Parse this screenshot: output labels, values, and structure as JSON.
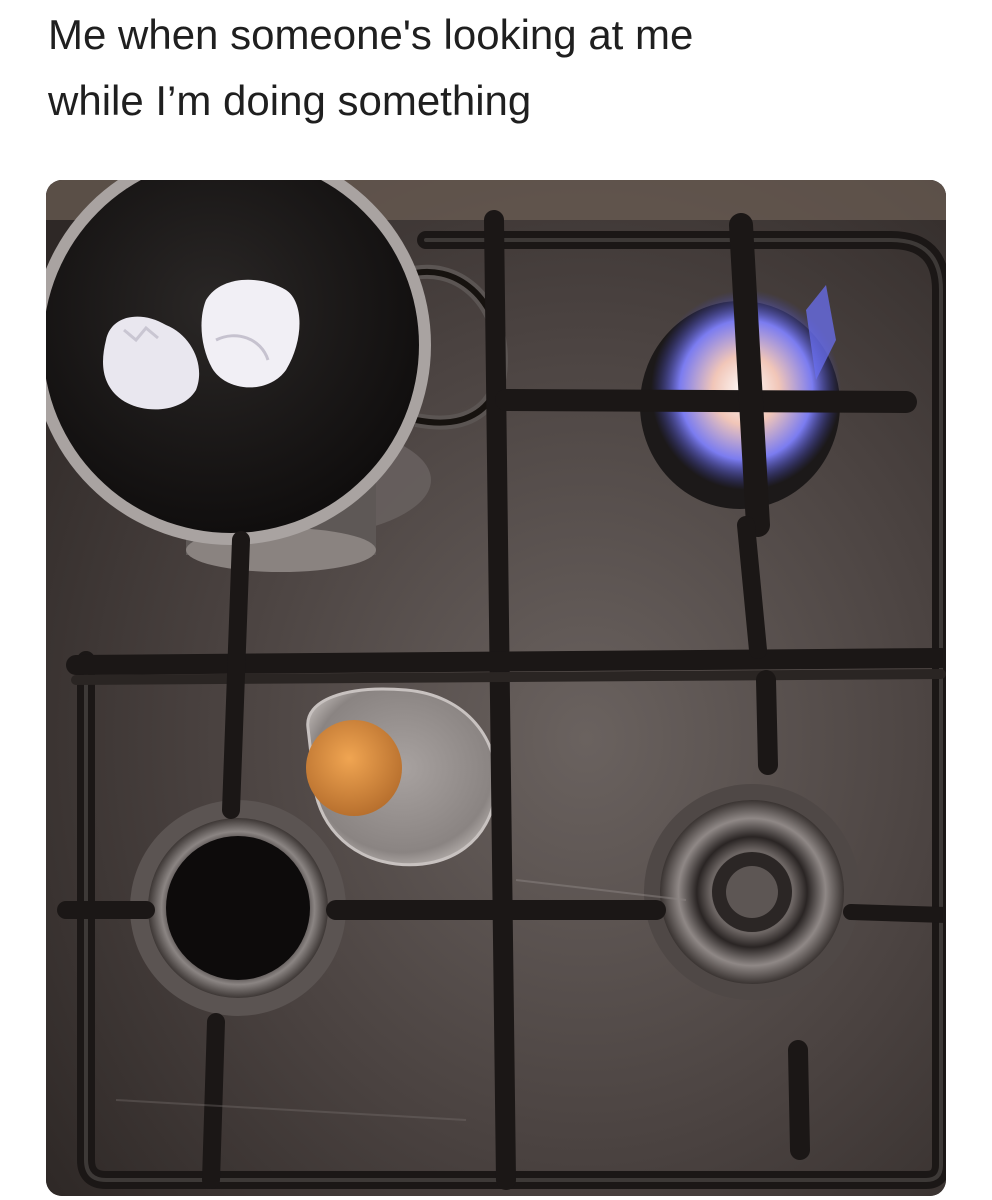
{
  "caption": {
    "line1": "Me when someone's looking at me",
    "line2": "while I’m doing something"
  },
  "photo": {
    "subject": "stovetop-with-egg-cooked-on-grate-and-shells-in-pan"
  },
  "colors": {
    "background": "#ffffff",
    "caption_text": "#1f1f1f",
    "stove_surface": "#4a403a",
    "grate": "#1b1716",
    "flame": "#5a6fe0",
    "yolk": "#d98a3f"
  }
}
